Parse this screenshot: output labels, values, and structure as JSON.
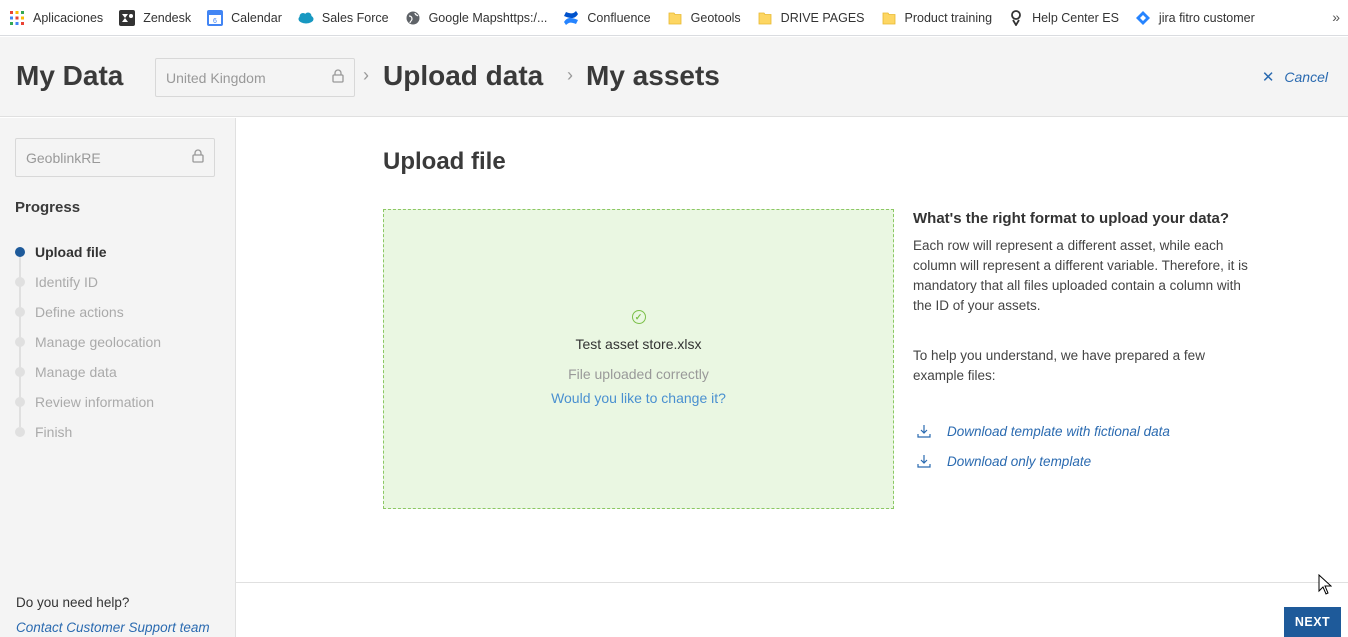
{
  "bookmarks": [
    {
      "label": "Aplicaciones",
      "icon": "apps-grid-icon"
    },
    {
      "label": "Zendesk",
      "icon": "zendesk-icon"
    },
    {
      "label": "Calendar",
      "icon": "calendar-icon"
    },
    {
      "label": "Sales Force",
      "icon": "salesforce-cloud-icon"
    },
    {
      "label": "Google Mapshttps:/...",
      "icon": "globe-icon"
    },
    {
      "label": "Confluence",
      "icon": "confluence-icon"
    },
    {
      "label": "Geotools",
      "icon": "folder-icon"
    },
    {
      "label": "DRIVE PAGES",
      "icon": "folder-icon"
    },
    {
      "label": "Product training",
      "icon": "folder-icon"
    },
    {
      "label": "Help Center ES",
      "icon": "zendesk-guide-icon"
    },
    {
      "label": "jira fitro customer",
      "icon": "jira-icon"
    }
  ],
  "bookmarks_more": "»",
  "header": {
    "title": "My Data",
    "country": "United Kingdom",
    "crumbs": [
      "Upload data",
      "My assets"
    ],
    "crumb_sep": "›",
    "cancel": "Cancel"
  },
  "sidebar": {
    "account": "GeoblinkRE",
    "progress_title": "Progress",
    "steps": [
      {
        "label": "Upload file",
        "active": true
      },
      {
        "label": "Identify ID",
        "active": false
      },
      {
        "label": "Define actions",
        "active": false
      },
      {
        "label": "Manage geolocation",
        "active": false
      },
      {
        "label": "Manage data",
        "active": false
      },
      {
        "label": "Review information",
        "active": false
      },
      {
        "label": "Finish",
        "active": false
      }
    ],
    "help_question": "Do you need help?",
    "help_link": "Contact Customer Support team"
  },
  "main": {
    "title": "Upload file",
    "file_name": "Test asset store.xlsx",
    "file_status": "File uploaded correctly",
    "change_link": "Would you like to change it?"
  },
  "info": {
    "heading": "What's the right format to upload your data?",
    "paragraph1": "Each row will represent a different asset, while each column will represent a different variable. Therefore, it is mandatory that all files uploaded contain a column with the ID of your assets.",
    "paragraph2": "To help you understand, we have prepared a few example files:",
    "download_fictional": "Download template with fictional data",
    "download_template": "Download only template"
  },
  "footer": {
    "next": "NEXT"
  },
  "colors": {
    "primary": "#1e5a9a",
    "link": "#2a6ab0",
    "success_bg": "#eaf7e2",
    "success_border": "#8cc864"
  }
}
